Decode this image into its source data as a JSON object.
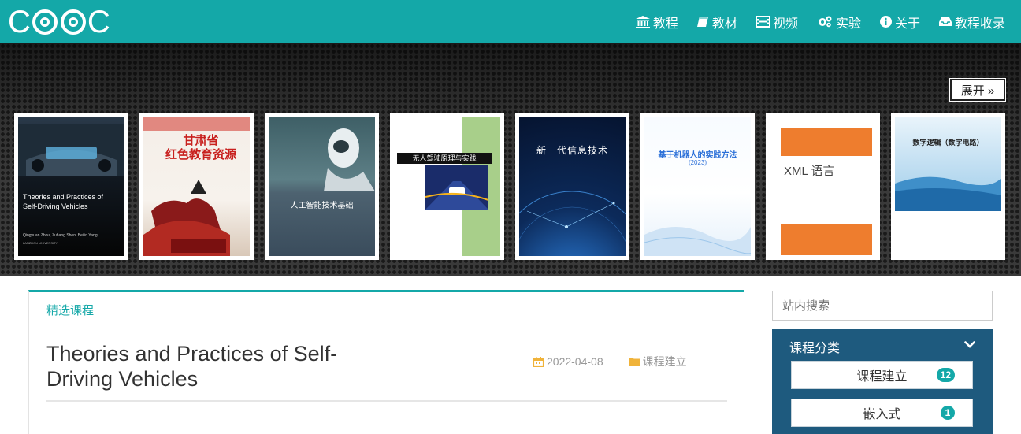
{
  "nav": {
    "logo_letters": [
      "C",
      "C"
    ],
    "items": [
      {
        "label": "教程",
        "icon": "bank-icon"
      },
      {
        "label": "教材",
        "icon": "book-icon"
      },
      {
        "label": "视频",
        "icon": "film-icon"
      },
      {
        "label": "实验",
        "icon": "cogs-icon"
      },
      {
        "label": "关于",
        "icon": "info-circle-icon"
      },
      {
        "label": "教程收录",
        "icon": "inbox-icon"
      }
    ]
  },
  "banner": {
    "expand_label": "展开 »",
    "covers": [
      {
        "title_line1": "Theories and Practices of",
        "title_line2": "Self-Driving Vehicles",
        "authors": "Qingyuan Zhou, Zuhang Shen, Beilin Yang",
        "publisher": "LANZHOU UNIVERSITY"
      },
      {
        "title_line1": "甘肃省",
        "title_line2": "红色教育资源"
      },
      {
        "title": "人工智能技术基础"
      },
      {
        "title": "无人驾驶原理与实践"
      },
      {
        "title": "新一代信息技术"
      },
      {
        "title": "基于机器人的实践方法",
        "subtitle": "(2023)"
      },
      {
        "title": "XML 语言"
      },
      {
        "title": "数字逻辑（数字电路）"
      }
    ]
  },
  "main": {
    "section_label": "精选课程",
    "post_title": "Theories and Practices of Self-Driving Vehicles",
    "date": "2022-04-08",
    "category": "课程建立"
  },
  "sidebar": {
    "search_placeholder": "站内搜索",
    "category_header": "课程分类",
    "categories": [
      {
        "label": "课程建立",
        "count": "12"
      },
      {
        "label": "嵌入式",
        "count": "1"
      }
    ]
  },
  "colors": {
    "accent": "#14a8a8",
    "panel": "#1e5a7e"
  }
}
